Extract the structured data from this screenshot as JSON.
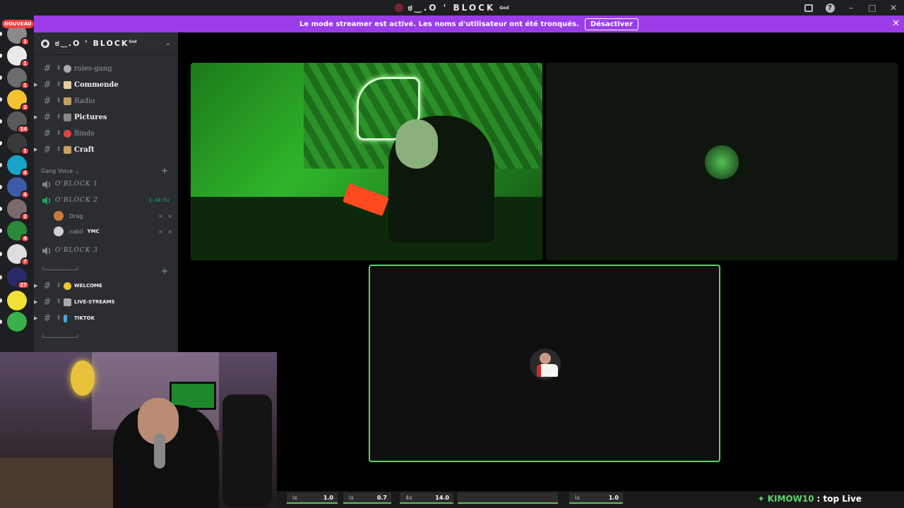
{
  "window": {
    "title": "ಠ‿.O ' BLOCK",
    "title_sup": "God"
  },
  "banner": {
    "message": "Le mode streamer est activé. Les noms d'utilisateur ont été tronqués.",
    "button": "Désactiver"
  },
  "rail": {
    "new_badge": "NOUVEAU",
    "servers": [
      {
        "badge": "1",
        "color": "#8a8a8a"
      },
      {
        "badge": "1",
        "color": "#e9e9e9"
      },
      {
        "badge": "1",
        "color": "#6c6c6c"
      },
      {
        "badge": "2",
        "color": "#f2c232"
      },
      {
        "badge": "14",
        "color": "#5a5a5a"
      },
      {
        "badge": "1",
        "color": "#3a3a3a"
      },
      {
        "badge": "4",
        "color": "#1aa3c9"
      },
      {
        "badge": "4",
        "color": "#3c5aa8"
      },
      {
        "badge": "2",
        "color": "#7a6a6a"
      },
      {
        "badge": "4",
        "color": "#2a8a3a"
      },
      {
        "badge": "7",
        "color": "#ddd"
      },
      {
        "badge": "27",
        "color": "#2a2a6a"
      },
      {
        "badge": "",
        "color": "#f1e035"
      },
      {
        "badge": "",
        "color": "#3ab04a"
      }
    ]
  },
  "sidebar": {
    "server_name": "ಠ‿.O ' BLOCK",
    "server_sup": "God",
    "channels": [
      {
        "name": "roles-gang",
        "emoji_color": "#aaaaaa"
      },
      {
        "name": "Commende",
        "emoji_color": "#e8c9a0"
      },
      {
        "name": "Radio",
        "emoji_color": "#c0a060"
      },
      {
        "name": "Pictures",
        "emoji_color": "#888888"
      },
      {
        "name": "Binds",
        "emoji_color": "#d44"
      },
      {
        "name": "Craft",
        "emoji_color": "#c8a060"
      }
    ],
    "voice_category": "Gang Voice",
    "voice_channels": [
      {
        "name": "O'BLOCK 1"
      },
      {
        "name": "O'BLOCK 2",
        "time": "3:48:51"
      },
      {
        "name": "O'BLOCK 3"
      }
    ],
    "members": [
      {
        "name": "Drag",
        "tag": "",
        "color": "#c87a3a"
      },
      {
        "name": "nabil",
        "tag": "YMC",
        "color": "#cfcfcf"
      }
    ],
    "decor_line": "╰────────────╯",
    "lower_channels": [
      {
        "name": "WELCOME",
        "emoji_color": "#f2c232"
      },
      {
        "name": "LIVE-STREAMS",
        "emoji_color": "#aaaaaa"
      },
      {
        "name": "TIKTOK",
        "emoji_color": "#4aa8d8"
      }
    ]
  },
  "bottombar": {
    "sliders": [
      {
        "k": "lx",
        "v": "1.0"
      },
      {
        "k": "lx",
        "v": "0.7"
      },
      {
        "k": "4x",
        "v": "14.0"
      },
      {
        "k": "",
        "v": ""
      },
      {
        "k": "lx",
        "v": "1.0"
      }
    ]
  },
  "chat": {
    "user": "KIMOW10",
    "message": ": top Live"
  }
}
